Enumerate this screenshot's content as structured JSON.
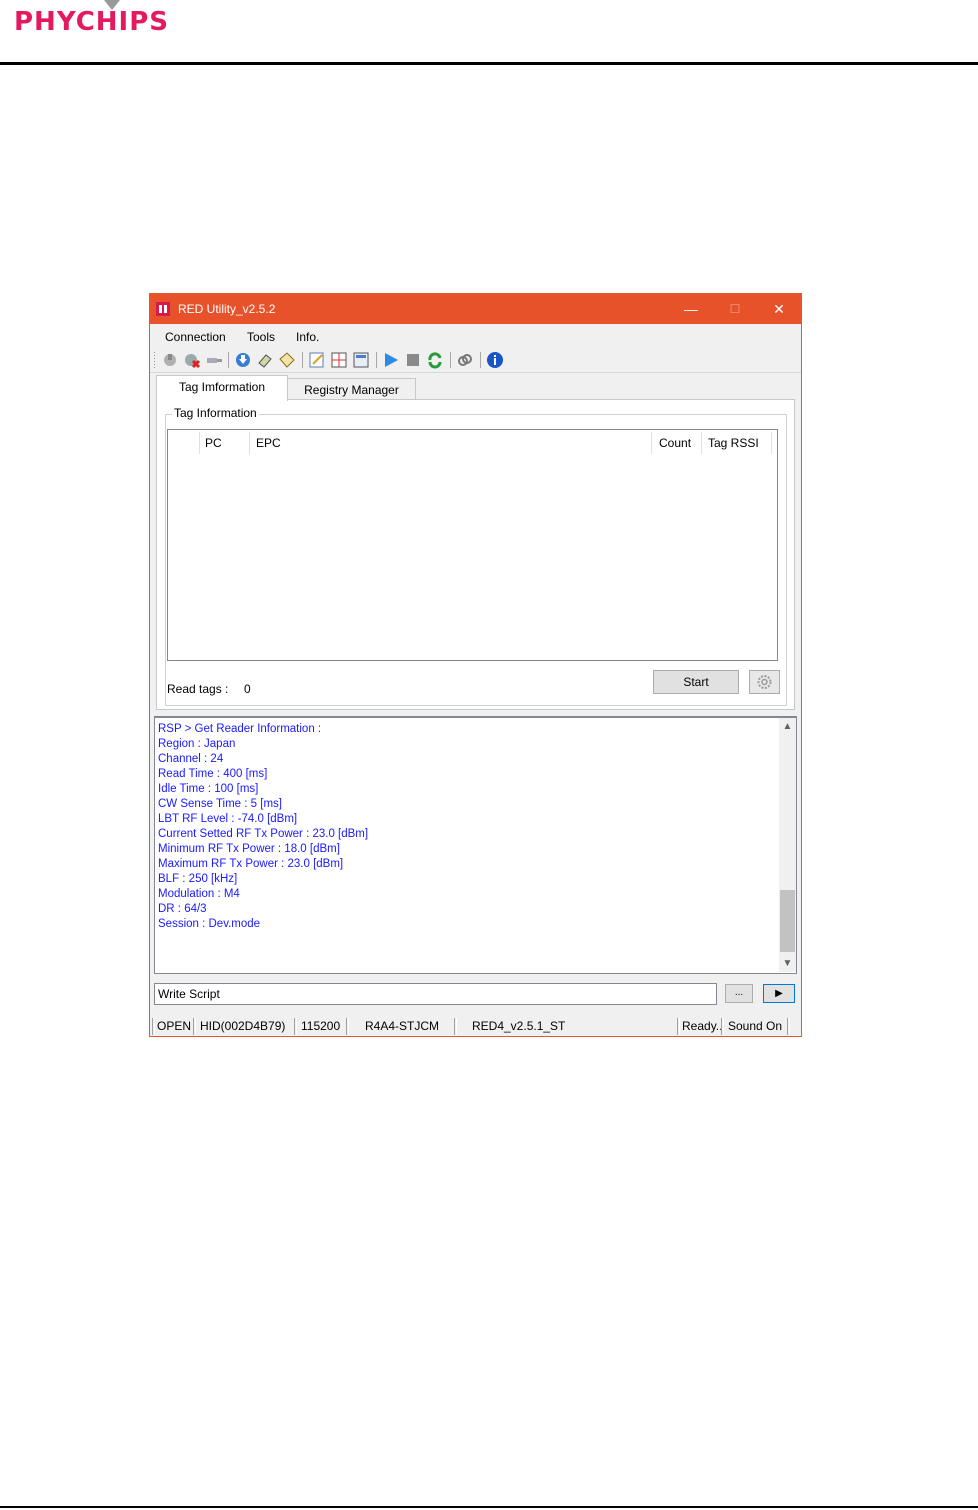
{
  "document": {
    "logo_text": "PHYCHIPS"
  },
  "window": {
    "title": "RED Utility_v2.5.2",
    "controls": {
      "minimize": "—",
      "maximize": "☐",
      "close": "✕"
    }
  },
  "menu": {
    "items": [
      {
        "label": "Connection"
      },
      {
        "label": "Tools"
      },
      {
        "label": "Info."
      }
    ]
  },
  "toolbar": {
    "icons": [
      "connect-icon",
      "disconnect-icon",
      "plug-icon",
      "download-icon",
      "eraser-icon",
      "tag-icon",
      "edit-icon",
      "grid-icon",
      "memory-icon",
      "play-icon",
      "stop-icon",
      "refresh-icon",
      "link-icon",
      "info-icon"
    ]
  },
  "tabs": [
    {
      "label": "Tag Imformation"
    },
    {
      "label": "Registry Manager"
    }
  ],
  "tag_info": {
    "group_label": "Tag Information",
    "columns": [
      "PC",
      "EPC",
      "Count",
      "Tag RSSI"
    ],
    "rows": [],
    "read_tags_label": "Read tags :",
    "read_tags_value": "0",
    "start_label": "Start"
  },
  "log": {
    "lines": [
      "RSP > Get Reader Information :",
      "Region : Japan",
      "Channel : 24",
      "Read Time : 400 [ms]",
      "Idle Time : 100 [ms]",
      "CW Sense Time : 5 [ms]",
      "LBT RF Level : -74.0 [dBm]",
      "Current Setted RF Tx Power : 23.0 [dBm]",
      "Minimum RF Tx Power : 18.0 [dBm]",
      "Maximum RF Tx Power : 23.0 [dBm]",
      "BLF : 250 [kHz]",
      "Modulation : M4",
      "DR :  64/3",
      "Session : Dev.mode"
    ]
  },
  "script": {
    "value": "Write Script",
    "browse_label": "...",
    "run_label": "▶"
  },
  "status": {
    "state": "OPEN",
    "device": "HID(002D4B79)",
    "baud": "115200",
    "model": "R4A4-STJCM",
    "firmware": "RED4_v2.5.1_ST",
    "ready": "Ready..",
    "sound": "Sound On"
  },
  "colors": {
    "titlebar": "#e8522a",
    "log_text": "#1a1aff"
  }
}
